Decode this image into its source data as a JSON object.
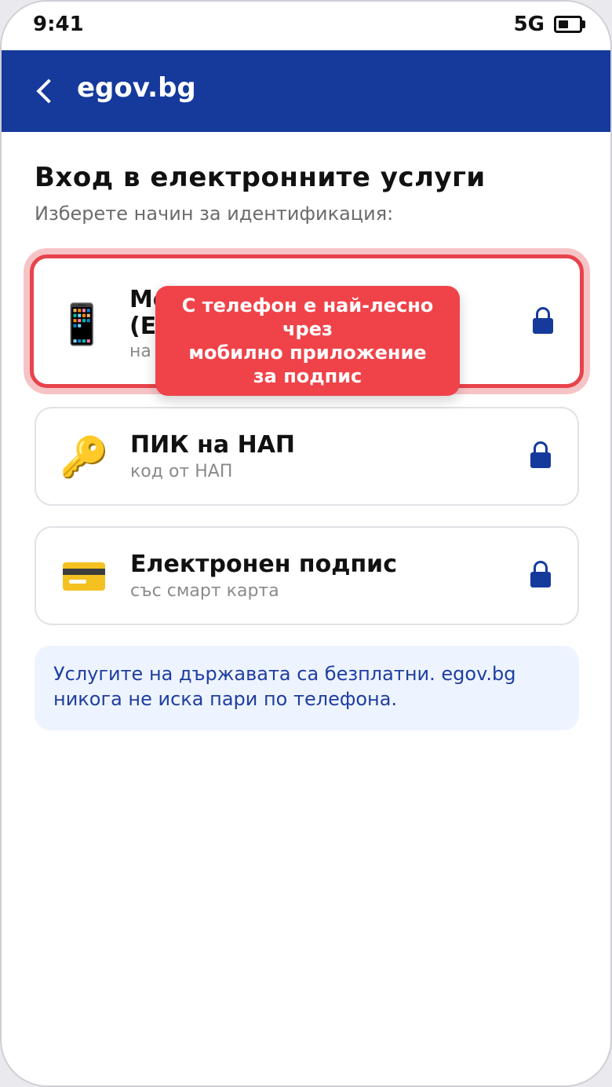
{
  "status_bar": {
    "time": "9:41",
    "network": "5G",
    "battery_level": 0.5
  },
  "header": {
    "title": "egov.bg",
    "back_icon": "chevron-left-icon"
  },
  "page": {
    "title": "Вход в електронните услуги",
    "subtitle": "Изберете начин за идентификация:"
  },
  "options": [
    {
      "title": "Мобилно приложение (ЕГН)",
      "title_line1": "Мо",
      "title_line2": "(Е",
      "subtitle_visible": "на",
      "icon": "📱",
      "icon_name": "mobile-phone-icon",
      "lock_icon": "lock-icon",
      "highlighted": true
    },
    {
      "title": "ПИК на НАП",
      "subtitle": "код от НАП",
      "icon": "🔑",
      "icon_name": "key-icon",
      "lock_icon": "lock-icon",
      "highlighted": false
    },
    {
      "title": "Електронен подпис",
      "subtitle": "със смарт карта",
      "icon_name": "credit-card-icon",
      "lock_icon": "lock-icon",
      "highlighted": false
    }
  ],
  "tooltip": {
    "line1": "С телефон е най-лесно",
    "line2": "чрез",
    "line3": "мобилно приложение",
    "line4": "за подпис"
  },
  "info": {
    "text": "Услугите на държавата са безплатни. egov.bg никога не иска пари по телефона."
  },
  "colors": {
    "brand": "#153a9c",
    "highlight": "#e8434b",
    "tooltip": "#ef4349",
    "info_bg": "#eef4ff",
    "info_text": "#1f3ea0"
  }
}
